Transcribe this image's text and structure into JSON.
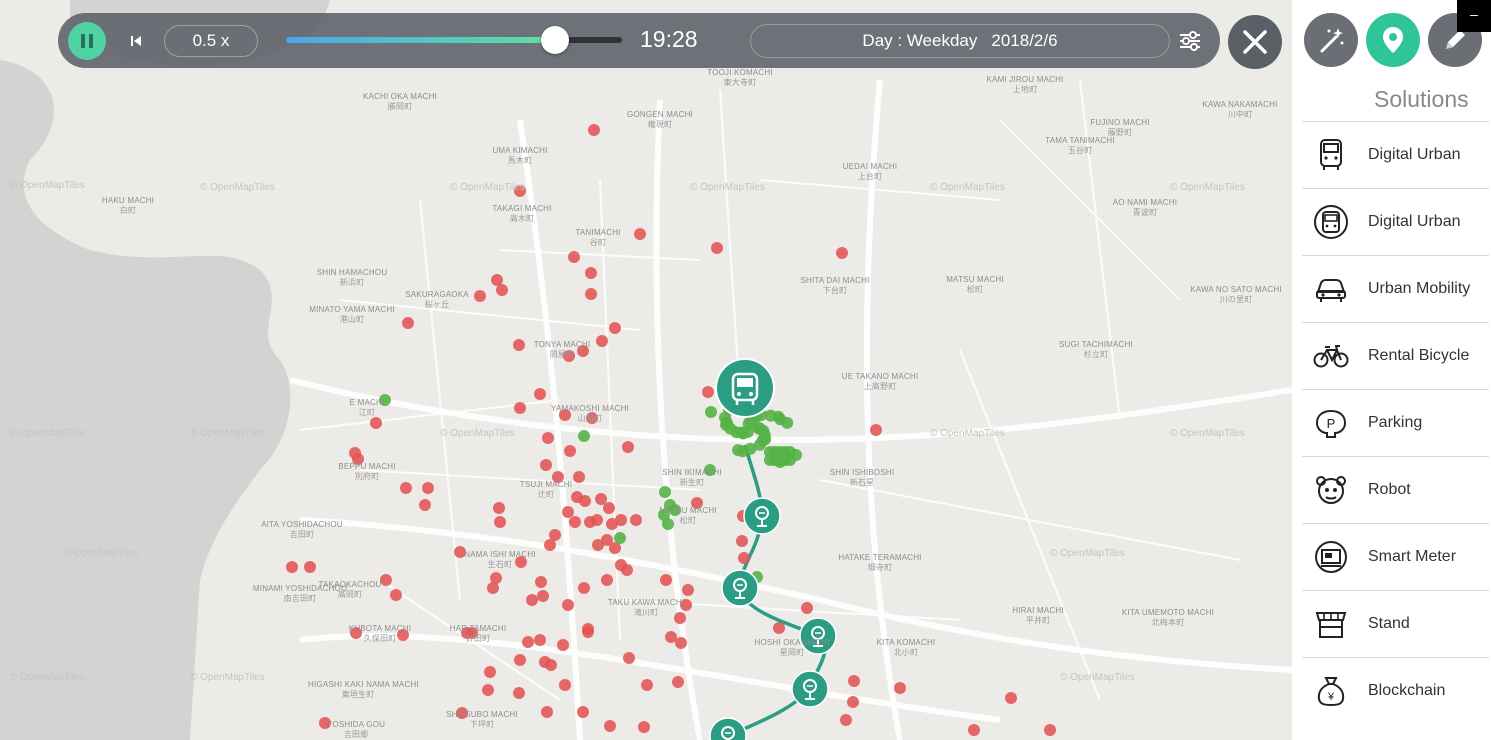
{
  "playback": {
    "speed": "0.5 x",
    "progress": 0.8,
    "time": "19:28",
    "day_label": "Day : Weekday",
    "date": "2018/2/6"
  },
  "colors": {
    "accent": "#2a9d84",
    "play_button": "#4fd3a4",
    "demand_point": "#e35454",
    "supply_point": "#55b347",
    "route": "#2a9d84"
  },
  "map": {
    "attribution": "© OpenMapTiles",
    "districts": [
      {
        "name": "KACHI OKA MACHI",
        "jp": "勝岡町"
      },
      {
        "name": "GONGEN MACHI",
        "jp": "権現町"
      },
      {
        "name": "TOOJI KOMACHI",
        "jp": "東大寺町"
      },
      {
        "name": "KAMI JIROU MACHI",
        "jp": "上地町"
      },
      {
        "name": "KAWA NAKAMACHI",
        "jp": "川中町"
      },
      {
        "name": "UMA KIMACHI",
        "jp": "馬木町"
      },
      {
        "name": "FUJINO MACHI",
        "jp": "藤野町"
      },
      {
        "name": "TAMA TANIMACHI",
        "jp": "玉谷町"
      },
      {
        "name": "UEDAI MACHI",
        "jp": "上台町"
      },
      {
        "name": "HAKU MACHI",
        "jp": "白町"
      },
      {
        "name": "TAKAGI MACHI",
        "jp": "高木町"
      },
      {
        "name": "AO NAMI MACHI",
        "jp": "青波町"
      },
      {
        "name": "TANIMACHI",
        "jp": "谷町"
      },
      {
        "name": "SHIN HAMACHOU",
        "jp": "新浜町"
      },
      {
        "name": "SAKURAGAOKA",
        "jp": "桜ヶ丘"
      },
      {
        "name": "SHITA DAI MACHI",
        "jp": "下台町"
      },
      {
        "name": "MATSU MACHI",
        "jp": "松町"
      },
      {
        "name": "KAWA NO SATO MACHI",
        "jp": "川の里町"
      },
      {
        "name": "MINATO YAMA MACHI",
        "jp": "港山町"
      },
      {
        "name": "TONYA MACHI",
        "jp": "問屋町"
      },
      {
        "name": "SUGI TACHIMACHI",
        "jp": "杉立町"
      },
      {
        "name": "UE TAKANO MACHI",
        "jp": "上高野町"
      },
      {
        "name": "E MACHI",
        "jp": "江町"
      },
      {
        "name": "YAMAKOSHI MACHI",
        "jp": "山越町"
      },
      {
        "name": "BEPPU MACHI",
        "jp": "別府町"
      },
      {
        "name": "SHIN ISHIBOSHI",
        "jp": "新石星"
      },
      {
        "name": "SHIN IKIMACHI",
        "jp": "新生町"
      },
      {
        "name": "TSUJI MACHI",
        "jp": "辻町"
      },
      {
        "name": "MATSU MACHI",
        "jp": "松町"
      },
      {
        "name": "AITA YOSHIDACHOU",
        "jp": "吉田町"
      },
      {
        "name": "NAMA ISHI MACHI",
        "jp": "生石町"
      },
      {
        "name": "HATAKE TERAMACHI",
        "jp": "畑寺町"
      },
      {
        "name": "TAKAOKACHOU",
        "jp": "高岡町"
      },
      {
        "name": "MINAMI YOSHIDACHOU",
        "jp": "南吉田町"
      },
      {
        "name": "TAKU KAWA MACHI",
        "jp": "滝川町"
      },
      {
        "name": "HIRAI MACHI",
        "jp": "平井町"
      },
      {
        "name": "KITA UMEMOTO MACHI",
        "jp": "北梅本町"
      },
      {
        "name": "KUBOTA MACHI",
        "jp": "久保田町"
      },
      {
        "name": "HAR TAMACHI",
        "jp": "針田町"
      },
      {
        "name": "HOSHI OKA MACHI",
        "jp": "星岡町"
      },
      {
        "name": "KITA KOMACHI",
        "jp": "北小町"
      },
      {
        "name": "HIGASHI KAKI NAMA MACHI",
        "jp": "東垣生町"
      },
      {
        "name": "SHITSUBO MACHI",
        "jp": "下坪町"
      },
      {
        "name": "YOSHIDA GOU",
        "jp": "吉田郷"
      }
    ],
    "bus_stops": 5,
    "bus_icon": "bus-icon",
    "stop_icon": "bus-stop-icon"
  },
  "panel": {
    "tools": [
      {
        "icon": "magic-wand-icon"
      },
      {
        "icon": "map-pin-icon",
        "active": true
      },
      {
        "icon": "pencil-icon"
      }
    ],
    "minimize": "–",
    "title": "Solutions",
    "items": [
      {
        "label": "Digital Urban",
        "icon": "bus-front-icon"
      },
      {
        "label": "Digital Urban",
        "icon": "bus-rotate-icon"
      },
      {
        "label": "Urban Mobility",
        "icon": "car-icon"
      },
      {
        "label": "Rental Bicycle",
        "icon": "bicycle-icon"
      },
      {
        "label": "Parking",
        "icon": "parking-icon"
      },
      {
        "label": "Robot",
        "icon": "robot-icon"
      },
      {
        "label": "Smart Meter",
        "icon": "smart-meter-icon"
      },
      {
        "label": "Stand",
        "icon": "stand-icon"
      },
      {
        "label": "Blockchain",
        "icon": "money-bag-icon"
      }
    ]
  }
}
